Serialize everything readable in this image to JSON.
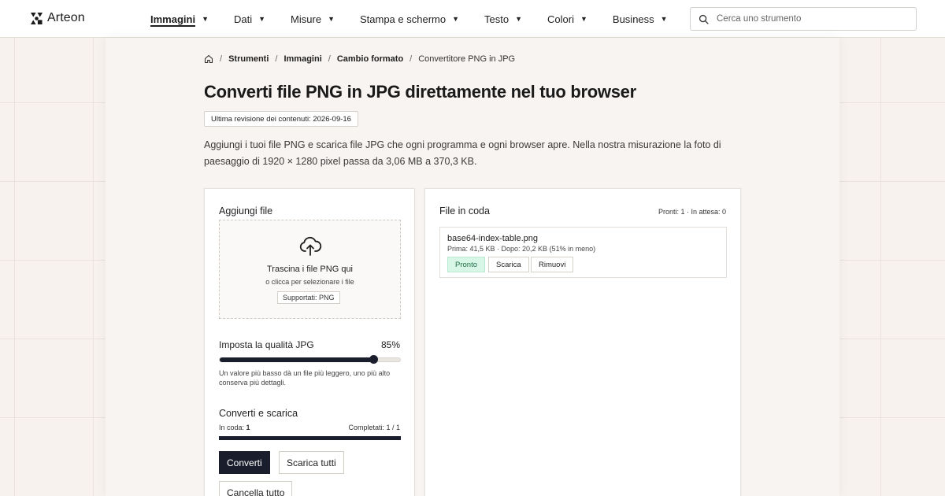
{
  "brand": {
    "name": "Arteon"
  },
  "nav": {
    "items": [
      {
        "label": "Immagini",
        "active": true
      },
      {
        "label": "Dati",
        "active": false
      },
      {
        "label": "Misure",
        "active": false
      },
      {
        "label": "Stampa e schermo",
        "active": false
      },
      {
        "label": "Testo",
        "active": false
      },
      {
        "label": "Colori",
        "active": false
      },
      {
        "label": "Business",
        "active": false
      }
    ]
  },
  "search": {
    "placeholder": "Cerca uno strumento"
  },
  "breadcrumb": {
    "items": [
      "Strumenti",
      "Immagini",
      "Cambio formato"
    ],
    "current": "Convertitore PNG in JPG"
  },
  "page": {
    "title": "Converti file PNG in JPG direttamente nel tuo browser",
    "revision": "Ultima revisione dei contenuti: 2026-09-16",
    "intro": "Aggiungi i tuoi file PNG e scarica file JPG che ogni programma e ogni browser apre. Nella nostra misurazione la foto di paesaggio di 1920 × 1280 pixel passa da 3,06 MB a 370,3 KB."
  },
  "upload": {
    "heading": "Aggiungi file",
    "drop_title": "Trascina i file PNG qui",
    "drop_sub": "o clicca per selezionare i file",
    "supported": "Supportati: PNG"
  },
  "quality": {
    "label": "Imposta la qualità JPG",
    "value_label": "85%",
    "value": 85,
    "help": "Un valore più basso dà un file più leggero, uno più alto conserva più dettagli."
  },
  "convert": {
    "heading": "Converti e scarica",
    "queue_label": "In coda:",
    "queue_count": "1",
    "completed": "Completati: 1 / 1",
    "progress": 1.0,
    "convert_label": "Converti",
    "download_all_label": "Scarica tutti",
    "clear_label": "Cancella tutto"
  },
  "queue": {
    "heading": "File in coda",
    "status": "Pronti: 1 · In attesa: 0",
    "files": [
      {
        "name": "base64-index-table.png",
        "meta": "Prima: 41,5 KB · Dopo: 20,2 KB (51% in meno)",
        "status_label": "Pronto",
        "download_label": "Scarica",
        "remove_label": "Rimuovi"
      }
    ]
  },
  "colors": {
    "accent": "#1a1e2c",
    "ready_bg": "#d8f6e6",
    "ready_text": "#1f6e46"
  },
  "icons": {
    "logo": "arteon-logo-icon",
    "search": "search-icon",
    "home": "home-icon",
    "upload": "cloud-upload-icon",
    "caret": "chevron-down-icon"
  }
}
